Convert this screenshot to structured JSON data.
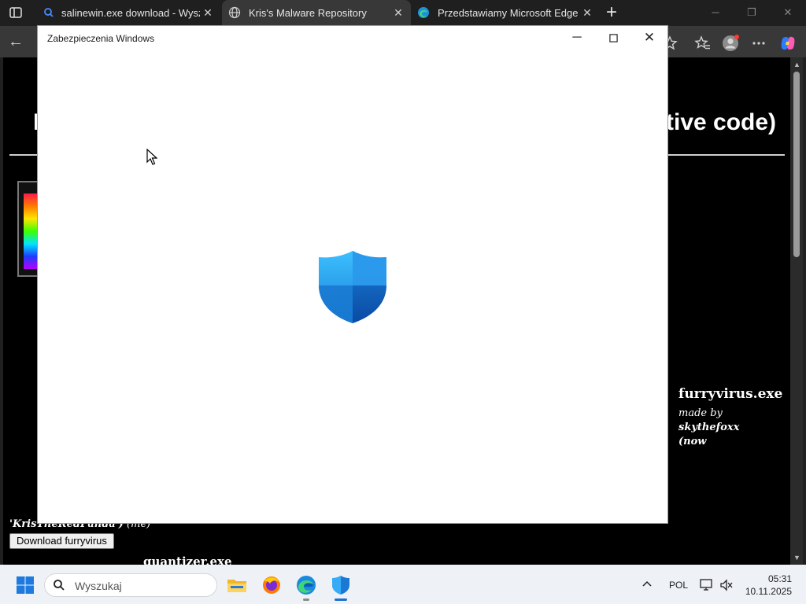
{
  "browser": {
    "tabs": [
      {
        "title": "salinewin.exe download - Wyszuk",
        "active": false,
        "icon": "search-icon"
      },
      {
        "title": "Kris's Malware Repository",
        "active": true,
        "icon": "globe-icon"
      },
      {
        "title": "Przedstawiamy Microsoft Edge",
        "active": false,
        "icon": "edge-icon"
      }
    ],
    "new_tab_label": "+"
  },
  "page": {
    "heading_left_fragment": "K",
    "heading_right_fragment": "tive code)",
    "furry_title": "furryvirus.exe",
    "furry_made_by_prefix": "made by",
    "furry_author": "skythefoxx",
    "furry_now": "(now",
    "kris_line_bold": "'KrisTheRedPanda')",
    "kris_line_rest": " (me)",
    "download_button": "Download furryvirus",
    "next_title": "quantizer.exe"
  },
  "dialog": {
    "title": "Zabezpieczenia Windows",
    "icon": "windows-security-shield-icon"
  },
  "taskbar": {
    "search_placeholder": "Wyszukaj",
    "language": "POL",
    "time": "05:31",
    "date": "10.11.2025",
    "apps": [
      "file-explorer-icon",
      "firefox-icon",
      "edge-icon",
      "windows-security-icon"
    ]
  },
  "colors": {
    "shield_light": "#35b4ff",
    "shield_dark": "#0b4fa8",
    "taskbar_bg": "#eef1f6",
    "tab_active_bg": "#383838"
  }
}
